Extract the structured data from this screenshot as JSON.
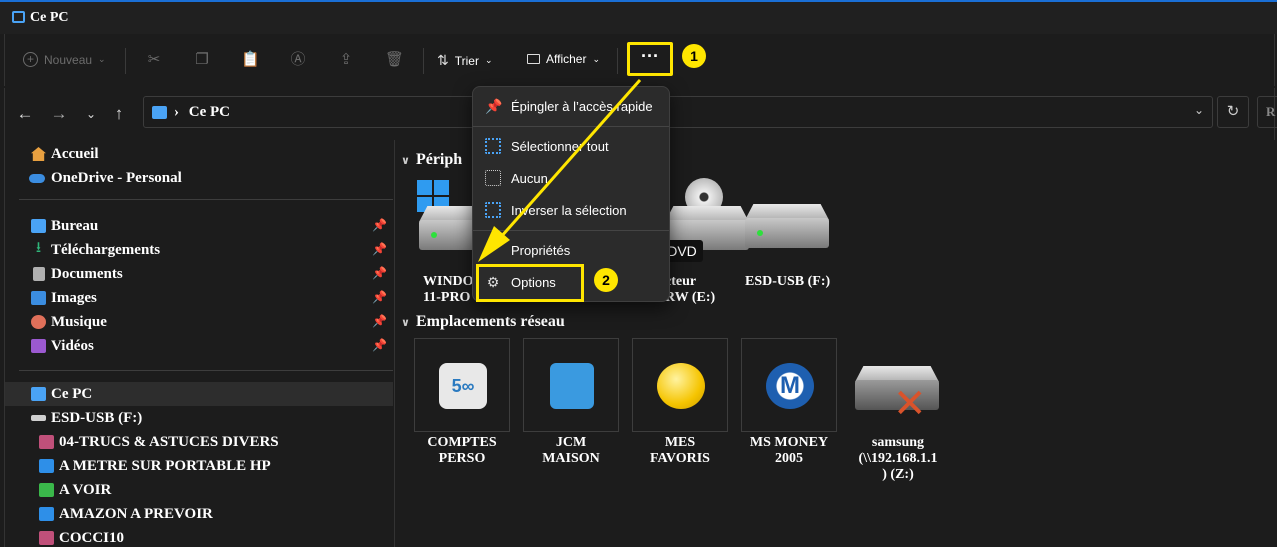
{
  "window": {
    "title": "Ce PC"
  },
  "toolbar": {
    "new_label": "Nouveau",
    "sort_label": "Trier",
    "view_label": "Afficher",
    "more_label": "···"
  },
  "annotations": {
    "badge1": "1",
    "badge2": "2",
    "accent_color": "#ffe600"
  },
  "address": {
    "path": "Ce PC",
    "separator": "›",
    "search_placeholder": "R"
  },
  "sidebar": {
    "quick": [
      {
        "label": "Accueil",
        "icon": "home-icon",
        "color": "#e8a040"
      },
      {
        "label": "OneDrive - Personal",
        "icon": "cloud-icon",
        "color": "#3b8de0"
      }
    ],
    "pinned": [
      {
        "label": "Bureau",
        "icon": "desktop-icon",
        "color": "#4aa3f5"
      },
      {
        "label": "Téléchargements",
        "icon": "download-icon",
        "color": "#2fb67a"
      },
      {
        "label": "Documents",
        "icon": "document-icon",
        "color": "#b0b0b0"
      },
      {
        "label": "Images",
        "icon": "image-icon",
        "color": "#3b8de0"
      },
      {
        "label": "Musique",
        "icon": "music-icon",
        "color": "#e0705a"
      },
      {
        "label": "Vidéos",
        "icon": "video-icon",
        "color": "#9b59d0"
      }
    ],
    "drives": [
      {
        "label": "Ce PC",
        "icon": "pc-icon",
        "color": "#4aa3f5",
        "selected": true
      },
      {
        "label": "ESD-USB (F:)",
        "icon": "drive-icon",
        "color": "#cfcfcf"
      },
      {
        "label": "04-TRUCS & ASTUCES DIVERS",
        "icon": "folder-icon",
        "color": "#c0507a"
      },
      {
        "label": "A METRE SUR PORTABLE HP",
        "icon": "folder-icon",
        "color": "#2e8fe8"
      },
      {
        "label": "A VOIR",
        "icon": "folder-icon",
        "color": "#3ab84a"
      },
      {
        "label": "AMAZON A PREVOIR",
        "icon": "folder-icon",
        "color": "#2e8fe8"
      },
      {
        "label": "COCCI10",
        "icon": "folder-icon",
        "color": "#c0507a"
      }
    ]
  },
  "content": {
    "devices_header": "Périph",
    "network_header": "Emplacements réseau",
    "devices": [
      {
        "label_line1": "WINDO",
        "label_line2": "11-PRO"
      },
      {
        "label_line1": "DVD",
        "label_line2": ""
      },
      {
        "label_line1": "cteur",
        "label_line2": "RW (E:)"
      },
      {
        "label_line1": "ESD-USB (F:)",
        "label_line2": ""
      }
    ],
    "network": [
      {
        "line1": "COMPTES",
        "line2": "PERSO",
        "line3": "",
        "icon": "500-icon",
        "color": "#e8e8e8"
      },
      {
        "line1": "JCM",
        "line2": "MAISON",
        "line3": "",
        "icon": "cabinet-icon",
        "color": "#3a9ae0"
      },
      {
        "line1": "MES",
        "line2": "FAVORIS",
        "line3": "",
        "icon": "coin-icon",
        "color": "#f5c400"
      },
      {
        "line1": "MS MONEY",
        "line2": "2005",
        "line3": "",
        "icon": "money-icon",
        "color": "#1e5fb0"
      },
      {
        "line1": "samsung",
        "line2": "(\\\\192.168.1.1",
        "line3": ") (Z:)",
        "icon": "disconnected-drive-icon",
        "color": "#8a8a8a"
      }
    ]
  },
  "menu": {
    "items": [
      {
        "label": "Épingler à l’accès rapide",
        "icon": "pin-icon"
      },
      {
        "label": "Sélectionner tout",
        "icon": "select-all-icon"
      },
      {
        "label": "Aucun",
        "icon": "select-none-icon"
      },
      {
        "label": "Inverser la sélection",
        "icon": "invert-selection-icon"
      },
      {
        "label": "Propriétés",
        "icon": "properties-icon"
      },
      {
        "label": "Options",
        "icon": "gear-icon"
      }
    ]
  }
}
